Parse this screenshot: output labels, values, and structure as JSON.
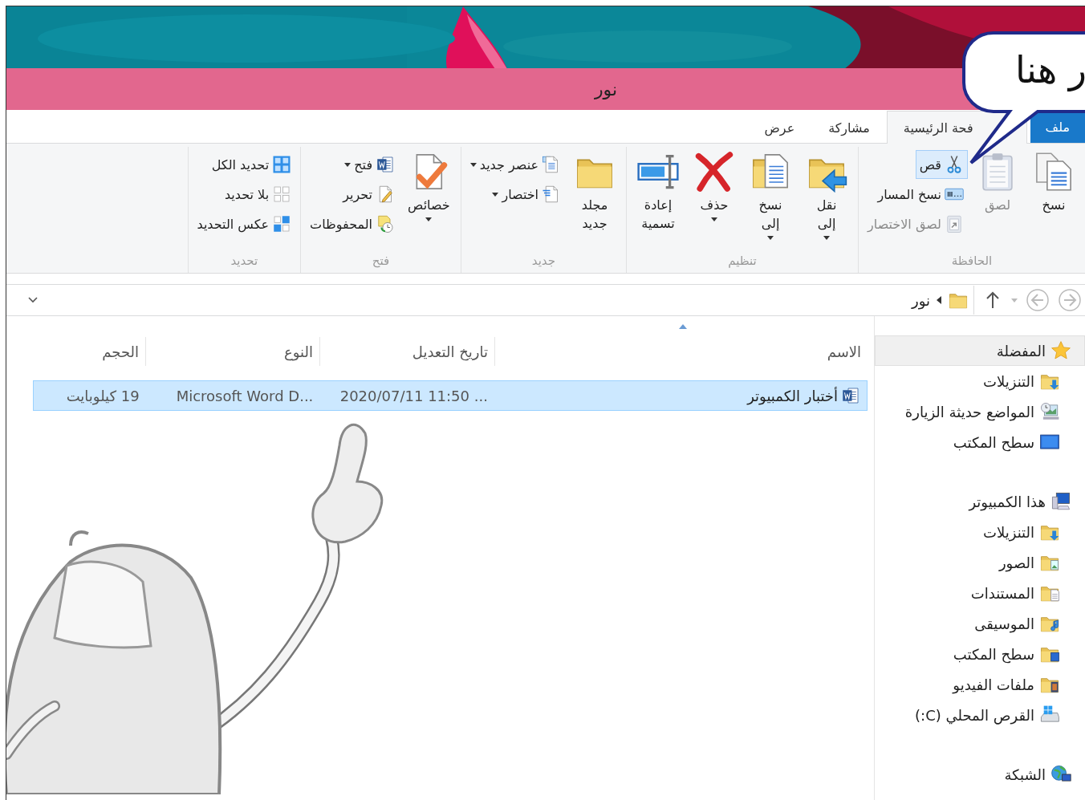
{
  "window": {
    "title": "نور"
  },
  "speech_bubble": {
    "text": "ر هنا"
  },
  "tabs": [
    {
      "label": "ملف",
      "kind": "file",
      "selected": false
    },
    {
      "label": "فحة الرئيسية",
      "kind": "tab",
      "selected": true
    },
    {
      "label": "مشاركة",
      "kind": "tab",
      "selected": false
    },
    {
      "label": "عرض",
      "kind": "tab",
      "selected": false
    }
  ],
  "ribbon": {
    "groups": [
      {
        "label": "الحافظة",
        "buttons": [
          {
            "kind": "large",
            "label": "نسخ",
            "dropdown": false,
            "disabled": false,
            "highlighted": false
          },
          {
            "kind": "large",
            "label": "لصق",
            "dropdown": false,
            "disabled": true,
            "highlighted": false
          },
          {
            "kind": "small",
            "label": "قص",
            "dropdown": false,
            "disabled": false,
            "highlighted": true
          },
          {
            "kind": "small",
            "label": "نسخ المسار",
            "dropdown": false,
            "disabled": false,
            "highlighted": false
          },
          {
            "kind": "small",
            "label": "لصق الاختصار",
            "dropdown": false,
            "disabled": true,
            "highlighted": false
          }
        ]
      },
      {
        "label": "تنظيم",
        "buttons": [
          {
            "kind": "large",
            "label": "نقل إلى",
            "dropdown": true,
            "disabled": false,
            "highlighted": false
          },
          {
            "kind": "large",
            "label": "نسخ إلى",
            "dropdown": true,
            "disabled": false,
            "highlighted": false
          },
          {
            "kind": "large",
            "label": "حذف",
            "dropdown": true,
            "disabled": false,
            "highlighted": false
          },
          {
            "kind": "large",
            "label": "إعادة تسمية",
            "dropdown": false,
            "disabled": false,
            "highlighted": false
          }
        ]
      },
      {
        "label": "جديد",
        "buttons": [
          {
            "kind": "large",
            "label": "مجلد جديد",
            "dropdown": false,
            "disabled": false,
            "highlighted": false
          },
          {
            "kind": "small",
            "label": "عنصر جديد",
            "dropdown": true,
            "disabled": false,
            "highlighted": false
          },
          {
            "kind": "small",
            "label": "اختصار",
            "dropdown": true,
            "disabled": false,
            "highlighted": false
          }
        ]
      },
      {
        "label": "فتح",
        "buttons": [
          {
            "kind": "large",
            "label": "خصائص",
            "dropdown": true,
            "disabled": false,
            "highlighted": false
          },
          {
            "kind": "small",
            "label": "فتح",
            "dropdown": true,
            "disabled": false,
            "highlighted": false
          },
          {
            "kind": "small",
            "label": "تحرير",
            "dropdown": false,
            "disabled": false,
            "highlighted": false
          },
          {
            "kind": "small",
            "label": "المحفوظات",
            "dropdown": false,
            "disabled": false,
            "highlighted": false
          }
        ]
      },
      {
        "label": "تحديد",
        "buttons": [
          {
            "kind": "small",
            "label": "تحديد الكل",
            "dropdown": false,
            "disabled": false,
            "highlighted": false
          },
          {
            "kind": "small",
            "label": "بلا تحديد",
            "dropdown": false,
            "disabled": false,
            "highlighted": false
          },
          {
            "kind": "small",
            "label": "عكس التحديد",
            "dropdown": false,
            "disabled": false,
            "highlighted": false
          }
        ]
      }
    ]
  },
  "address_bar": {
    "path": "نور"
  },
  "file_list": {
    "columns": [
      {
        "label": "الاسم",
        "sorted": true
      },
      {
        "label": "تاريخ التعديل",
        "sorted": false
      },
      {
        "label": "النوع",
        "sorted": false
      },
      {
        "label": "الحجم",
        "sorted": false
      }
    ],
    "rows": [
      {
        "name": "أختبار الكمبيوتر",
        "date": "2020/07/11 11:50 ...",
        "type": "Microsoft Word D...",
        "size": "19 كيلوبايت",
        "selected": true
      }
    ]
  },
  "navigation": {
    "items": [
      {
        "label": "المفضلة",
        "selected": true,
        "children": [
          {
            "label": "التنزيلات",
            "selected": false
          },
          {
            "label": "المواضع حديثة الزيارة",
            "selected": false
          },
          {
            "label": "سطح المكتب",
            "selected": false
          }
        ]
      },
      {
        "label": "هذا الكمبيوتر",
        "selected": false,
        "children": [
          {
            "label": "التنزيلات",
            "selected": false
          },
          {
            "label": "الصور",
            "selected": false
          },
          {
            "label": "المستندات",
            "selected": false
          },
          {
            "label": "الموسيقى",
            "selected": false
          },
          {
            "label": "سطح المكتب",
            "selected": false
          },
          {
            "label": "ملفات الفيديو",
            "selected": false
          },
          {
            "label": "القرص المحلي (C:)",
            "selected": false
          }
        ]
      },
      {
        "label": "الشبكة",
        "selected": false
      }
    ]
  }
}
